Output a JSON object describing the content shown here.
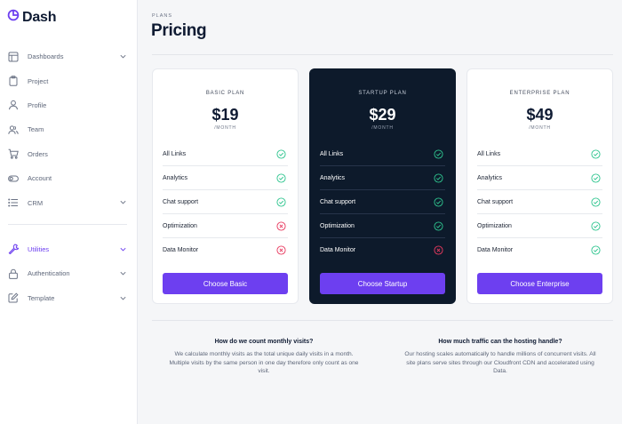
{
  "colors": {
    "accent": "#6d3ff0",
    "check": "#2fc58f",
    "cross": "#e83a5f",
    "dark_card": "#0d1a2b"
  },
  "brand": {
    "name": "Dash",
    "icon": "pie-logo-icon"
  },
  "sidebar": {
    "items": [
      {
        "label": "Dashboards",
        "icon": "layout-icon",
        "chevron": true
      },
      {
        "label": "Project",
        "icon": "clipboard-icon",
        "chevron": false
      },
      {
        "label": "Profile",
        "icon": "user-icon",
        "chevron": false
      },
      {
        "label": "Team",
        "icon": "users-icon",
        "chevron": false
      },
      {
        "label": "Orders",
        "icon": "cart-icon",
        "chevron": false
      },
      {
        "label": "Account",
        "icon": "toggle-icon",
        "chevron": false
      },
      {
        "label": "CRM",
        "icon": "list-icon",
        "chevron": true
      }
    ],
    "items2": [
      {
        "label": "Utilities",
        "icon": "wrench-icon",
        "chevron": true,
        "active": true
      },
      {
        "label": "Authentication",
        "icon": "lock-icon",
        "chevron": true
      },
      {
        "label": "Template",
        "icon": "edit-icon",
        "chevron": true
      }
    ]
  },
  "header": {
    "eyebrow": "PLANS",
    "title": "Pricing"
  },
  "plans": [
    {
      "name": "BASIC PLAN",
      "price": "$19",
      "period": "/MONTH",
      "dark": false,
      "button": "Choose Basic",
      "features": [
        {
          "label": "All Links",
          "included": true
        },
        {
          "label": "Analytics",
          "included": true
        },
        {
          "label": "Chat support",
          "included": true
        },
        {
          "label": "Optimization",
          "included": false
        },
        {
          "label": "Data Monitor",
          "included": false
        }
      ]
    },
    {
      "name": "STARTUP PLAN",
      "price": "$29",
      "period": "/MONTH",
      "dark": true,
      "button": "Choose Startup",
      "features": [
        {
          "label": "All Links",
          "included": true
        },
        {
          "label": "Analytics",
          "included": true
        },
        {
          "label": "Chat support",
          "included": true
        },
        {
          "label": "Optimization",
          "included": true
        },
        {
          "label": "Data Monitor",
          "included": false
        }
      ]
    },
    {
      "name": "ENTERPRISE PLAN",
      "price": "$49",
      "period": "/MONTH",
      "dark": false,
      "button": "Choose Enterprise",
      "features": [
        {
          "label": "All Links",
          "included": true
        },
        {
          "label": "Analytics",
          "included": true
        },
        {
          "label": "Chat support",
          "included": true
        },
        {
          "label": "Optimization",
          "included": true
        },
        {
          "label": "Data Monitor",
          "included": true
        }
      ]
    }
  ],
  "faq": [
    {
      "question": "How do we count monthly visits?",
      "answer": "We calculate monthly visits as the total unique daily visits in a month. Multiple visits by the same person in one day therefore only count as one visit."
    },
    {
      "question": "How much traffic can the hosting handle?",
      "answer": "Our hosting scales automatically to handle millions of concurrent visits. All site plans serve sites through our Cloudfront CDN and accelerated using Data."
    }
  ]
}
